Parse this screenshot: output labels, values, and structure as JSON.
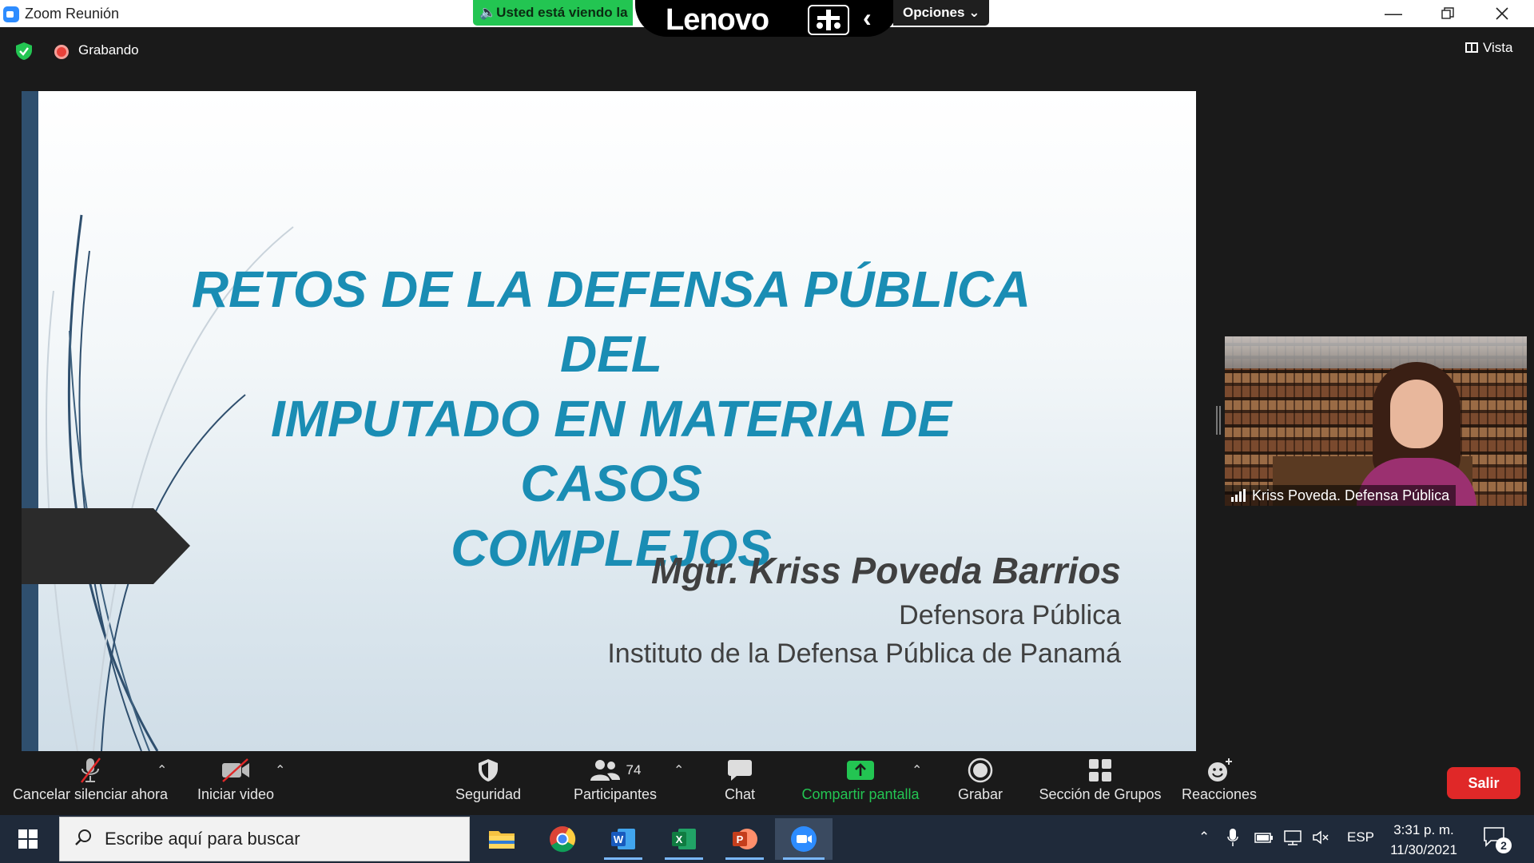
{
  "window": {
    "title": "Zoom Reunión"
  },
  "share_bar": {
    "viewing_text": "Usted está viendo la",
    "brand": "Lenovo",
    "options_label": "Opciones"
  },
  "meeting": {
    "recording_label": "Grabando",
    "view_label": "Vista"
  },
  "slide": {
    "title_lines": [
      "RETOS DE LA DEFENSA PÚBLICA DEL",
      "IMPUTADO EN MATERIA DE CASOS",
      "COMPLEJOS"
    ],
    "author": "Mgtr. Kriss Poveda Barrios",
    "role": "Defensora Pública",
    "organization": "Instituto de la Defensa Pública de Panamá",
    "title_color": "#1a8db4"
  },
  "participant_video": {
    "name": "Kriss Poveda. Defensa Pública"
  },
  "toolbar": {
    "mute_label": "Cancelar silenciar ahora",
    "video_label": "Iniciar video",
    "security_label": "Seguridad",
    "participants_label": "Participantes",
    "participants_count": "74",
    "chat_label": "Chat",
    "share_label": "Compartir pantalla",
    "record_label": "Grabar",
    "breakout_label": "Sección de Grupos",
    "reactions_label": "Reacciones",
    "leave_label": "Salir",
    "share_color": "#23c552",
    "leave_color": "#e02828"
  },
  "taskbar": {
    "search_placeholder": "Escribe aquí para buscar",
    "apps": [
      "file-explorer",
      "chrome",
      "word",
      "excel",
      "powerpoint",
      "zoom"
    ],
    "language": "ESP",
    "time": "3:31 p. m.",
    "date": "11/30/2021",
    "notifications_count": "2"
  }
}
